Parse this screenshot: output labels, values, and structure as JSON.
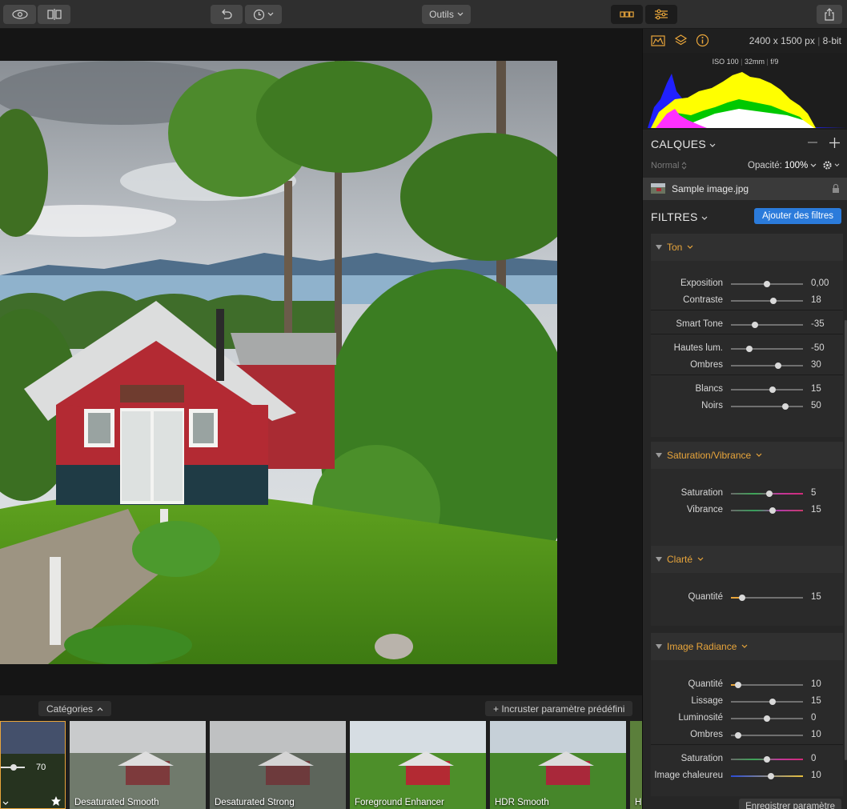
{
  "toolbar": {
    "tools_label": "Outils"
  },
  "photo": {
    "description_icon": "photo"
  },
  "presets": {
    "categories_label": "Catégories",
    "embed_label": "+ Incruster paramètre prédéfini",
    "current_amount": "70",
    "items": [
      {
        "label": "Desaturated Smooth"
      },
      {
        "label": "Desaturated Strong"
      },
      {
        "label": "Foreground Enhancer"
      },
      {
        "label": "HDR Smooth"
      },
      {
        "label": "H"
      }
    ]
  },
  "panel": {
    "dimensions": "2400 x 1500 px",
    "bitdepth": "8-bit",
    "exif": {
      "iso": "ISO 100",
      "focal": "32mm",
      "aperture": "f/9"
    },
    "layers": {
      "title": "CALQUES",
      "blend": "Normal",
      "opacity_label": "Opacité:",
      "opacity_value": "100%",
      "layer_name": "Sample image.jpg"
    },
    "filters": {
      "title": "FILTRES",
      "add_label": "Ajouter des filtres"
    },
    "groups": {
      "ton": {
        "title": "Ton",
        "rows": [
          {
            "name": "Exposition",
            "value": "0,00",
            "pos": 0.5
          },
          {
            "name": "Contraste",
            "value": "18",
            "pos": 0.59
          },
          {
            "name": "Smart Tone",
            "value": "-35",
            "pos": 0.33
          },
          {
            "name": "Hautes lum.",
            "value": "-50",
            "pos": 0.25
          },
          {
            "name": "Ombres",
            "value": "30",
            "pos": 0.65
          },
          {
            "name": "Blancs",
            "value": "15",
            "pos": 0.58
          },
          {
            "name": "Noirs",
            "value": "50",
            "pos": 0.75
          }
        ]
      },
      "saturation": {
        "title": "Saturation/Vibrance",
        "rows": [
          {
            "name": "Saturation",
            "value": "5",
            "pos": 0.53
          },
          {
            "name": "Vibrance",
            "value": "15",
            "pos": 0.58
          }
        ]
      },
      "clarte": {
        "title": "Clarté",
        "rows": [
          {
            "name": "Quantité",
            "value": "15",
            "pos": 0.15
          }
        ]
      },
      "radiance": {
        "title": "Image Radiance",
        "rows": [
          {
            "name": "Quantité",
            "value": "10",
            "pos": 0.1
          },
          {
            "name": "Lissage",
            "value": "15",
            "pos": 0.58
          },
          {
            "name": "Luminosité",
            "value": "0",
            "pos": 0.5
          },
          {
            "name": "Ombres",
            "value": "10",
            "pos": 0.1
          },
          {
            "name": "Saturation",
            "value": "0",
            "pos": 0.5
          },
          {
            "name": "Image chaleureu",
            "value": "10",
            "pos": 0.55
          }
        ]
      }
    },
    "save_preset_label": "Enregistrer paramètre"
  },
  "colors": {
    "accent": "#e8a53b",
    "blue": "#2b7bdb",
    "panel": "#262626"
  }
}
